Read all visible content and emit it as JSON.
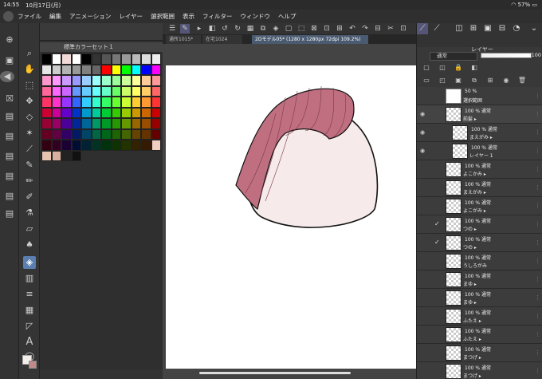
{
  "status": {
    "time": "14:55",
    "date": "10月17日(月)",
    "battery": "57%"
  },
  "menu": [
    "ファイル",
    "編集",
    "アニメーション",
    "レイヤー",
    "選択範囲",
    "表示",
    "フィルター",
    "ウィンドウ",
    "ヘルプ"
  ],
  "palette": {
    "title": "標準カラーセット１",
    "colors": [
      "#000000",
      "#ffffff",
      "#f4d9d9",
      "#ffffff",
      "#000000",
      "#333333",
      "#555555",
      "#777777",
      "#999999",
      "#bbbbbb",
      "#dddddd",
      "#eeeeee",
      "#e6e6e6",
      "#cccccc",
      "#b3b3b3",
      "#999999",
      "#808080",
      "#666666",
      "#ff0000",
      "#ffff00",
      "#00ff00",
      "#00ffff",
      "#0000ff",
      "#ff00ff",
      "#ff99cc",
      "#ff99ff",
      "#cc99ff",
      "#9999ff",
      "#99ccff",
      "#99ffff",
      "#99ffcc",
      "#99ff99",
      "#ccff99",
      "#ffff99",
      "#ffcc99",
      "#ff9999",
      "#ff6699",
      "#ff66ff",
      "#cc66ff",
      "#6699ff",
      "#66ccff",
      "#66ffff",
      "#66ffcc",
      "#66ff66",
      "#ccff66",
      "#ffff66",
      "#ffcc66",
      "#ff6666",
      "#ff3366",
      "#ff33cc",
      "#9933ff",
      "#3366ff",
      "#33ccff",
      "#33ffcc",
      "#33ff66",
      "#66ff33",
      "#ccff33",
      "#ffcc33",
      "#ff9933",
      "#ff3333",
      "#cc0033",
      "#cc0099",
      "#6600cc",
      "#0033cc",
      "#0099cc",
      "#00cc99",
      "#00cc33",
      "#33cc00",
      "#99cc00",
      "#cc9900",
      "#cc6600",
      "#cc0000",
      "#990033",
      "#990066",
      "#4d0099",
      "#002699",
      "#006699",
      "#009966",
      "#009926",
      "#269900",
      "#669900",
      "#996600",
      "#994d00",
      "#990000",
      "#660022",
      "#660044",
      "#330066",
      "#001a66",
      "#004466",
      "#006644",
      "#00661a",
      "#1a6600",
      "#446600",
      "#664400",
      "#663300",
      "#660000",
      "#330011",
      "#330022",
      "#1a0033",
      "#000d33",
      "#002233",
      "#003322",
      "#00330d",
      "#0d3300",
      "#223300",
      "#332200",
      "#331a00",
      "#f0d0c0",
      "#e8c4b0",
      "#d8b0a0",
      "#222222",
      "#111111"
    ]
  },
  "canvas": {
    "tabs": [
      {
        "label": "通所1015*"
      },
      {
        "label": "在宅1024"
      },
      {
        "label": "2Dモデル05* (1280 x 1280px 72dpi 109.2%)"
      }
    ],
    "skin_color": "#f6ebea",
    "hair_color": "#c06f80"
  },
  "layer_panel": {
    "title": "レイヤー",
    "blend_mode": "通常",
    "opacity": "100",
    "layers": [
      {
        "mode": "50 %",
        "name": "選択範囲",
        "type": "selarea",
        "eye": "",
        "check": ""
      },
      {
        "mode": "100 % 通常",
        "name": "前髪 ▸",
        "type": "folder",
        "eye": "◉",
        "check": ""
      },
      {
        "mode": "100 % 通常",
        "name": "まえがみ ▸",
        "type": "indent",
        "eye": "◉",
        "check": ""
      },
      {
        "mode": "100 % 通常",
        "name": "レイヤー 1",
        "type": "indent",
        "eye": "◉",
        "check": ""
      },
      {
        "mode": "100 % 通常",
        "name": "よこかみ ▸",
        "type": "normal",
        "eye": "",
        "check": ""
      },
      {
        "mode": "100 % 通常",
        "name": "まえがみ ▸",
        "type": "normal",
        "eye": "",
        "check": ""
      },
      {
        "mode": "100 % 通常",
        "name": "よこがみ ▸",
        "type": "normal",
        "eye": "",
        "check": ""
      },
      {
        "mode": "100 % 通常",
        "name": "つの ▸",
        "type": "normal",
        "eye": "",
        "check": "✓"
      },
      {
        "mode": "100 % 通常",
        "name": "つの ▸",
        "type": "normal",
        "eye": "",
        "check": "✓"
      },
      {
        "mode": "100 % 通常",
        "name": "うしろがみ",
        "type": "normal",
        "eye": "",
        "check": ""
      },
      {
        "mode": "100 % 通常",
        "name": "まゆ ▸",
        "type": "normal",
        "eye": "",
        "check": ""
      },
      {
        "mode": "100 % 通常",
        "name": "まゆ ▸",
        "type": "normal",
        "eye": "",
        "check": ""
      },
      {
        "mode": "100 % 通常",
        "name": "ふたえ ▸",
        "type": "normal",
        "eye": "",
        "check": ""
      },
      {
        "mode": "100 % 通常",
        "name": "ふたえ ▸",
        "type": "normal",
        "eye": "",
        "check": ""
      },
      {
        "mode": "100 % 通常",
        "name": "まつげ ▸",
        "type": "normal",
        "eye": "",
        "check": ""
      },
      {
        "mode": "100 % 通常",
        "name": "まつげ ▸",
        "type": "normal",
        "eye": "",
        "check": ""
      }
    ]
  }
}
